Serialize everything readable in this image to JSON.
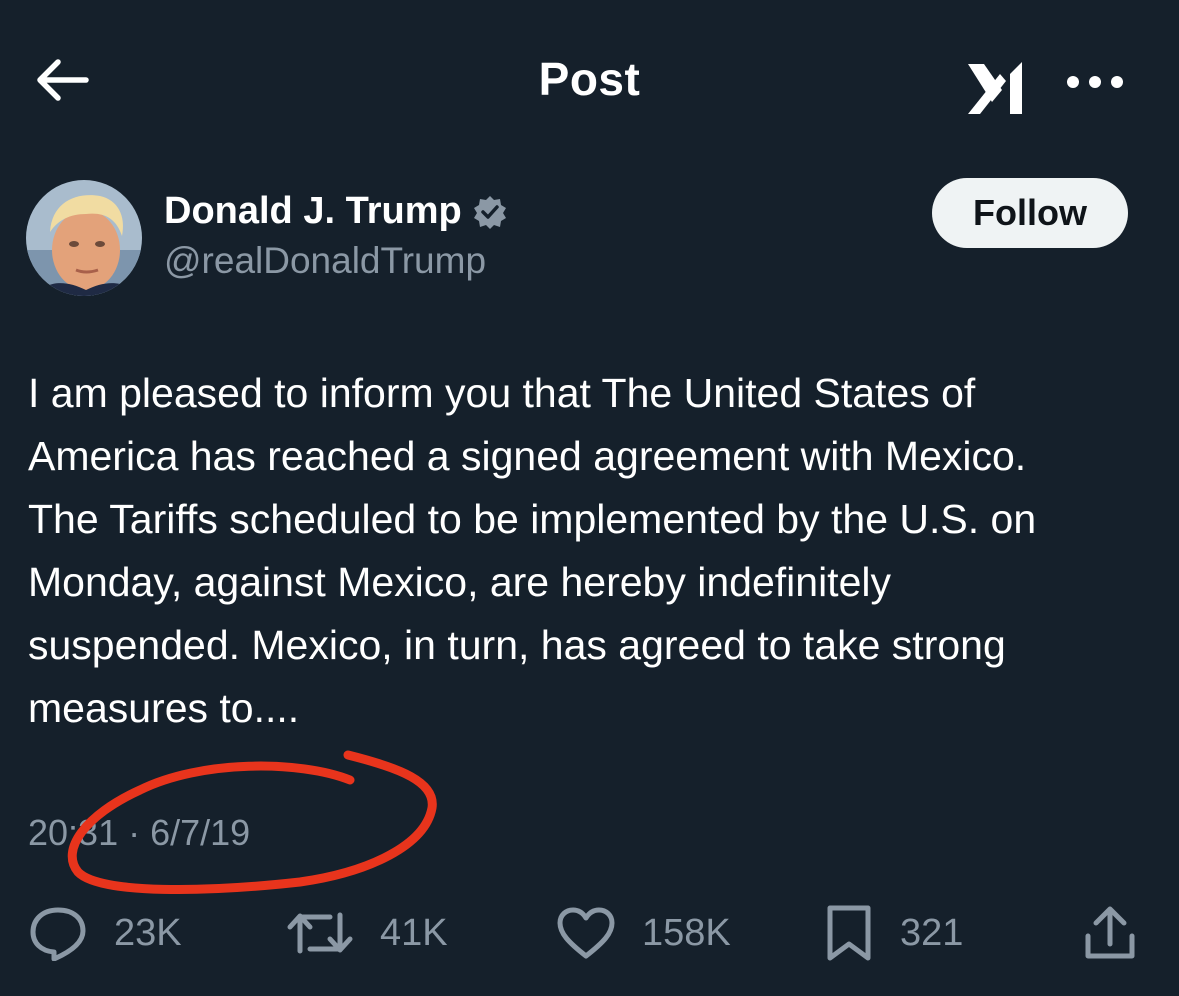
{
  "header": {
    "title": "Post",
    "back_icon": "arrow-left-icon",
    "grok_icon": "grok-icon",
    "more_icon": "more-horizontal-icon"
  },
  "author": {
    "name": "Donald J. Trump",
    "handle": "@realDonaldTrump",
    "verified_icon": "verified-badge-icon",
    "follow_label": "Follow"
  },
  "post": {
    "text": "I am pleased to inform you that The United States of\nAmerica has reached a signed agreement with Mexico.\nThe Tariffs scheduled to be implemented by the U.S. on\nMonday, against Mexico, are hereby indefinitely\nsuspended. Mexico, in turn, has agreed to take strong\nmeasures to....",
    "timestamp": "20:31 · 6/7/19"
  },
  "actions": {
    "replies": "23K",
    "reposts": "41K",
    "likes": "158K",
    "bookmarks": "321"
  },
  "colors": {
    "background": "#15202b",
    "secondary_text": "#8b98a5",
    "annotation": "#e8341c"
  }
}
